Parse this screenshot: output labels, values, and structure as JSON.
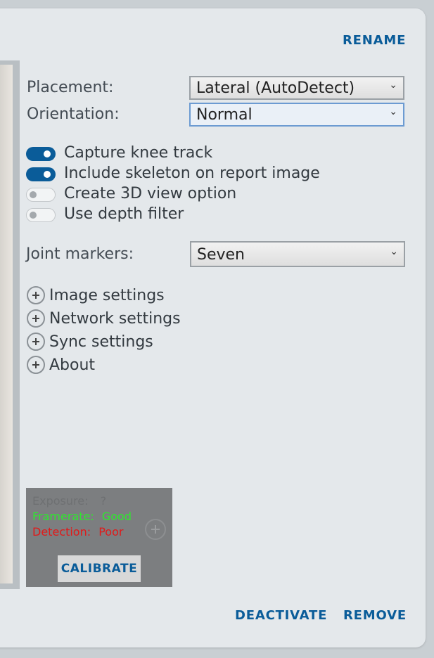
{
  "header": {
    "rename_label": "RENAME"
  },
  "settings": {
    "placement_label": "Placement:",
    "placement_value": "Lateral (AutoDetect)",
    "orientation_label": "Orientation:",
    "orientation_value": "Normal",
    "joint_markers_label": "Joint markers:",
    "joint_markers_value": "Seven"
  },
  "toggles": [
    {
      "label": "Capture knee track",
      "on": true
    },
    {
      "label": "Include skeleton on report image",
      "on": true
    },
    {
      "label": "Create 3D view option",
      "on": false
    },
    {
      "label": "Use depth filter",
      "on": false
    }
  ],
  "sections": [
    {
      "label": "Image settings"
    },
    {
      "label": "Network settings"
    },
    {
      "label": "Sync settings"
    },
    {
      "label": "About"
    }
  ],
  "status": {
    "exposure_label": "Exposure:",
    "exposure_value": "?",
    "framerate_label": "Framerate:",
    "framerate_value": "Good",
    "detection_label": "Detection:",
    "detection_value": "Poor",
    "calibrate_label": "CALIBRATE",
    "colors": {
      "exposure": "#6e7072",
      "good": "#2ee82e",
      "poor": "#e01a1a"
    }
  },
  "footer": {
    "deactivate_label": "DEACTIVATE",
    "remove_label": "REMOVE"
  },
  "colors": {
    "accent": "#0a5c99",
    "panel": "#e4e8eb",
    "background": "#c9cfd3"
  }
}
